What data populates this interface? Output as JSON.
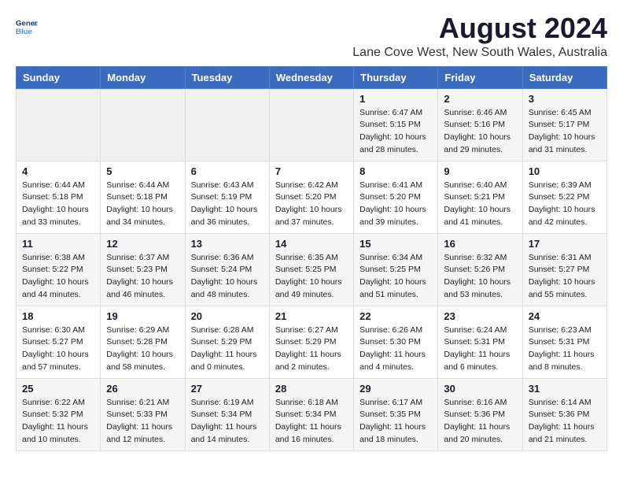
{
  "logo": {
    "line1": "General",
    "line2": "Blue"
  },
  "title": "August 2024",
  "subtitle": "Lane Cove West, New South Wales, Australia",
  "days_header": [
    "Sunday",
    "Monday",
    "Tuesday",
    "Wednesday",
    "Thursday",
    "Friday",
    "Saturday"
  ],
  "weeks": [
    [
      {
        "day": "",
        "info": ""
      },
      {
        "day": "",
        "info": ""
      },
      {
        "day": "",
        "info": ""
      },
      {
        "day": "",
        "info": ""
      },
      {
        "day": "1",
        "info": "Sunrise: 6:47 AM\nSunset: 5:15 PM\nDaylight: 10 hours\nand 28 minutes."
      },
      {
        "day": "2",
        "info": "Sunrise: 6:46 AM\nSunset: 5:16 PM\nDaylight: 10 hours\nand 29 minutes."
      },
      {
        "day": "3",
        "info": "Sunrise: 6:45 AM\nSunset: 5:17 PM\nDaylight: 10 hours\nand 31 minutes."
      }
    ],
    [
      {
        "day": "4",
        "info": "Sunrise: 6:44 AM\nSunset: 5:18 PM\nDaylight: 10 hours\nand 33 minutes."
      },
      {
        "day": "5",
        "info": "Sunrise: 6:44 AM\nSunset: 5:18 PM\nDaylight: 10 hours\nand 34 minutes."
      },
      {
        "day": "6",
        "info": "Sunrise: 6:43 AM\nSunset: 5:19 PM\nDaylight: 10 hours\nand 36 minutes."
      },
      {
        "day": "7",
        "info": "Sunrise: 6:42 AM\nSunset: 5:20 PM\nDaylight: 10 hours\nand 37 minutes."
      },
      {
        "day": "8",
        "info": "Sunrise: 6:41 AM\nSunset: 5:20 PM\nDaylight: 10 hours\nand 39 minutes."
      },
      {
        "day": "9",
        "info": "Sunrise: 6:40 AM\nSunset: 5:21 PM\nDaylight: 10 hours\nand 41 minutes."
      },
      {
        "day": "10",
        "info": "Sunrise: 6:39 AM\nSunset: 5:22 PM\nDaylight: 10 hours\nand 42 minutes."
      }
    ],
    [
      {
        "day": "11",
        "info": "Sunrise: 6:38 AM\nSunset: 5:22 PM\nDaylight: 10 hours\nand 44 minutes."
      },
      {
        "day": "12",
        "info": "Sunrise: 6:37 AM\nSunset: 5:23 PM\nDaylight: 10 hours\nand 46 minutes."
      },
      {
        "day": "13",
        "info": "Sunrise: 6:36 AM\nSunset: 5:24 PM\nDaylight: 10 hours\nand 48 minutes."
      },
      {
        "day": "14",
        "info": "Sunrise: 6:35 AM\nSunset: 5:25 PM\nDaylight: 10 hours\nand 49 minutes."
      },
      {
        "day": "15",
        "info": "Sunrise: 6:34 AM\nSunset: 5:25 PM\nDaylight: 10 hours\nand 51 minutes."
      },
      {
        "day": "16",
        "info": "Sunrise: 6:32 AM\nSunset: 5:26 PM\nDaylight: 10 hours\nand 53 minutes."
      },
      {
        "day": "17",
        "info": "Sunrise: 6:31 AM\nSunset: 5:27 PM\nDaylight: 10 hours\nand 55 minutes."
      }
    ],
    [
      {
        "day": "18",
        "info": "Sunrise: 6:30 AM\nSunset: 5:27 PM\nDaylight: 10 hours\nand 57 minutes."
      },
      {
        "day": "19",
        "info": "Sunrise: 6:29 AM\nSunset: 5:28 PM\nDaylight: 10 hours\nand 58 minutes."
      },
      {
        "day": "20",
        "info": "Sunrise: 6:28 AM\nSunset: 5:29 PM\nDaylight: 11 hours\nand 0 minutes."
      },
      {
        "day": "21",
        "info": "Sunrise: 6:27 AM\nSunset: 5:29 PM\nDaylight: 11 hours\nand 2 minutes."
      },
      {
        "day": "22",
        "info": "Sunrise: 6:26 AM\nSunset: 5:30 PM\nDaylight: 11 hours\nand 4 minutes."
      },
      {
        "day": "23",
        "info": "Sunrise: 6:24 AM\nSunset: 5:31 PM\nDaylight: 11 hours\nand 6 minutes."
      },
      {
        "day": "24",
        "info": "Sunrise: 6:23 AM\nSunset: 5:31 PM\nDaylight: 11 hours\nand 8 minutes."
      }
    ],
    [
      {
        "day": "25",
        "info": "Sunrise: 6:22 AM\nSunset: 5:32 PM\nDaylight: 11 hours\nand 10 minutes."
      },
      {
        "day": "26",
        "info": "Sunrise: 6:21 AM\nSunset: 5:33 PM\nDaylight: 11 hours\nand 12 minutes."
      },
      {
        "day": "27",
        "info": "Sunrise: 6:19 AM\nSunset: 5:34 PM\nDaylight: 11 hours\nand 14 minutes."
      },
      {
        "day": "28",
        "info": "Sunrise: 6:18 AM\nSunset: 5:34 PM\nDaylight: 11 hours\nand 16 minutes."
      },
      {
        "day": "29",
        "info": "Sunrise: 6:17 AM\nSunset: 5:35 PM\nDaylight: 11 hours\nand 18 minutes."
      },
      {
        "day": "30",
        "info": "Sunrise: 6:16 AM\nSunset: 5:36 PM\nDaylight: 11 hours\nand 20 minutes."
      },
      {
        "day": "31",
        "info": "Sunrise: 6:14 AM\nSunset: 5:36 PM\nDaylight: 11 hours\nand 21 minutes."
      }
    ]
  ]
}
